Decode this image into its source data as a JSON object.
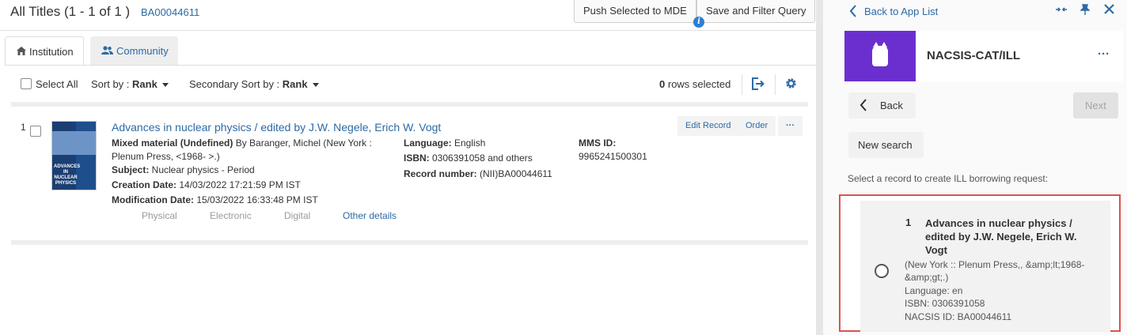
{
  "header": {
    "title": "All Titles (1 - 1 of 1 )",
    "query_id": "BA00044611",
    "push_button": "Push Selected to MDE",
    "save_button": "Save and Filter Query"
  },
  "tabs": [
    {
      "label": "Institution",
      "icon": "home-icon"
    },
    {
      "label": "Community",
      "icon": "users-icon"
    }
  ],
  "toolbar": {
    "select_all": "Select All",
    "sort_label": "Sort by :",
    "sort_value": "Rank",
    "secondary_sort_label": "Secondary Sort by :",
    "secondary_sort_value": "Rank",
    "rows_count": "0",
    "rows_selected_label": "rows selected"
  },
  "record": {
    "number": "1",
    "title": "Advances in nuclear physics / edited by J.W. Negele, Erich W. Vogt",
    "cover_text": "ADVANCES IN NUCLEAR PHYSICS",
    "type_label": "Mixed material (Undefined)",
    "author_line1": " By Baranger, Michel (New York :",
    "author_line2": "Plenum Press, <1968- >.)",
    "subject_label": "Subject:",
    "subject_value": " Nuclear physics - Period",
    "creation_label": "Creation Date:",
    "creation_value": " 14/03/2022 17:21:59 PM IST",
    "modification_label": "Modification Date:",
    "modification_value": " 15/03/2022 16:33:48 PM IST",
    "language_label": "Language:",
    "language_value": " English",
    "isbn_label": "ISBN:",
    "isbn_value": " 0306391058 and others",
    "recnum_label": "Record number:",
    "recnum_value": " (NII)BA00044611",
    "mms_label": "MMS ID:",
    "mms_value": "9965241500301",
    "edit_button": "Edit Record",
    "order_button": "Order",
    "more_button": "···",
    "links": [
      "Physical",
      "Electronic",
      "Digital",
      "Other details"
    ]
  },
  "panel": {
    "back_to_list": "Back to App List",
    "app_name": "NACSIS-CAT/ILL",
    "app_more": "···",
    "back_button": "Back",
    "next_button": "Next",
    "new_search_button": "New search",
    "instruction": "Select a record to create ILL borrowing request:",
    "result": {
      "number": "1",
      "title": "Advances in nuclear physics / edited by J.W. Negele, Erich W. Vogt",
      "publisher_line1": "(New York :: Plenum Press,, &amp;lt;1968-",
      "publisher_line2": "&amp;gt;.)",
      "language": "Language: en",
      "isbn": "ISBN: 0306391058",
      "nacsis_id": "NACSIS ID: BA00044611"
    }
  },
  "colors": {
    "link": "#2c6aa5",
    "app_brand": "#6b2fcf",
    "highlight_border": "#d9534f",
    "info": "#2d7fd1"
  }
}
